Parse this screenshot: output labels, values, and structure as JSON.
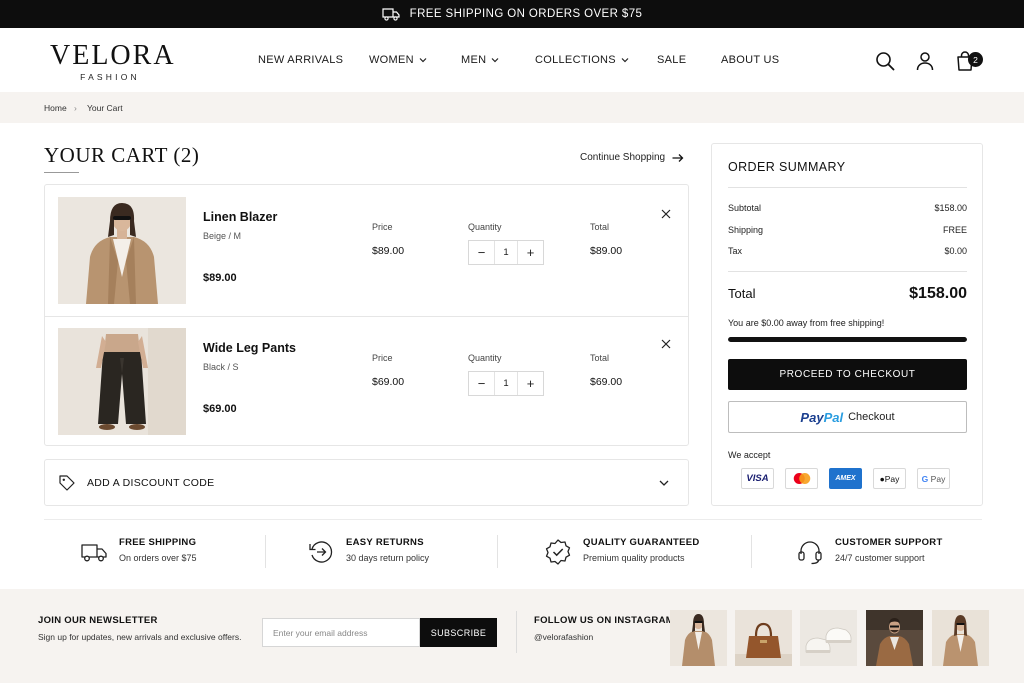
{
  "announcement": {
    "text": "FREE SHIPPING ON ORDERS OVER $75",
    "icon": "truck-icon"
  },
  "logo": {
    "brand": "VELORA",
    "sub": "FASHION"
  },
  "nav": [
    {
      "label": "NEW ARRIVALS",
      "dropdown": false
    },
    {
      "label": "WOMEN",
      "dropdown": true
    },
    {
      "label": "MEN",
      "dropdown": true
    },
    {
      "label": "COLLECTIONS",
      "dropdown": true
    },
    {
      "label": "SALE",
      "dropdown": false
    },
    {
      "label": "ABOUT US",
      "dropdown": false
    }
  ],
  "header_icons": {
    "search": "search-icon",
    "account": "user-icon",
    "cart": "shopping-bag-icon",
    "cart_count": "2"
  },
  "breadcrumb": {
    "home": "Home",
    "sep": "›",
    "current": "Your Cart"
  },
  "cart": {
    "title": "YOUR CART (2)",
    "continue": "Continue Shopping",
    "price_label": "Price",
    "quantity_label": "Quantity",
    "total_label": "Total",
    "items": [
      {
        "name": "Linen Blazer",
        "variant": "Beige / M",
        "price": "$89.00",
        "unit_price": "$89.00",
        "qty": "1",
        "total": "$89.00"
      },
      {
        "name": "Wide Leg Pants",
        "variant": "Black / S",
        "price": "$69.00",
        "unit_price": "$69.00",
        "qty": "1",
        "total": "$69.00"
      }
    ],
    "discount": "ADD A DISCOUNT CODE"
  },
  "summary": {
    "title": "ORDER SUMMARY",
    "subtotal_label": "Subtotal",
    "subtotal": "$158.00",
    "shipping_label": "Shipping",
    "shipping": "FREE",
    "tax_label": "Tax",
    "tax": "$0.00",
    "total_label": "Total",
    "total": "$158.00",
    "note": "You are $0.00 away from free shipping!",
    "progress": 1.0,
    "checkout": "PROCEED TO CHECKOUT",
    "paypal_a": "Pay",
    "paypal_b": "Pal",
    "paypal_c": "Checkout",
    "accept": "We accept",
    "cards": [
      "VISA",
      "Mastercard",
      "AMEX",
      "Apple Pay",
      "G Pay"
    ]
  },
  "features": [
    {
      "title": "FREE SHIPPING",
      "sub": "On orders over $75",
      "icon": "truck-icon"
    },
    {
      "title": "EASY RETURNS",
      "sub": "30 days return policy",
      "icon": "return-arrow-icon"
    },
    {
      "title": "QUALITY GUARANTEED",
      "sub": "Premium quality products",
      "icon": "quality-badge-icon"
    },
    {
      "title": "CUSTOMER SUPPORT",
      "sub": "24/7 customer support",
      "icon": "headset-icon"
    }
  ],
  "newsletter": {
    "title": "JOIN OUR NEWSLETTER",
    "sub": "Sign up for updates, new arrivals and exclusive offers.",
    "placeholder": "Enter your email address",
    "button": "SUBSCRIBE"
  },
  "instagram": {
    "title": "FOLLOW US ON INSTAGRAM",
    "handle": "@velorafashion"
  },
  "colors": {
    "accent": "#0d0d0d",
    "muted_bg": "#f6f3f0",
    "paypal_dark": "#1b3f8f",
    "paypal_light": "#2a9de0"
  }
}
